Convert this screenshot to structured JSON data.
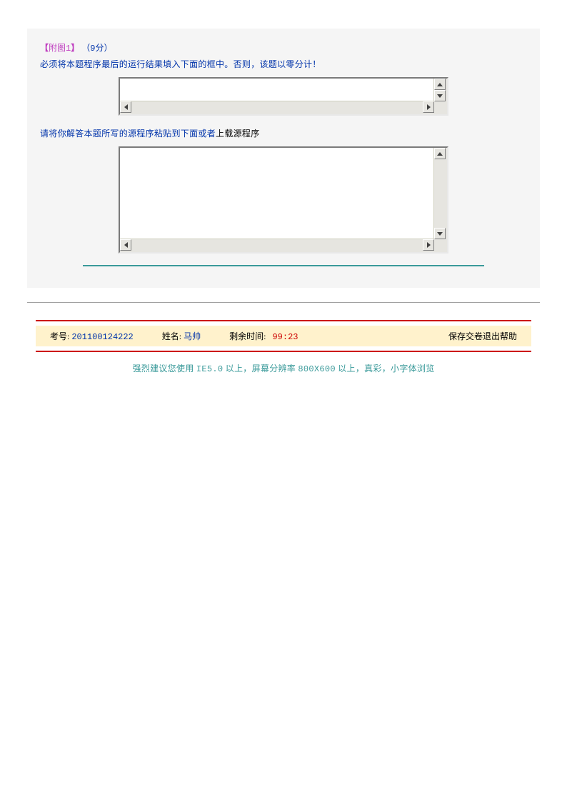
{
  "header": {
    "bracket_open": "【",
    "attach_label": "附图",
    "attach_num": "1",
    "bracket_close": "】",
    "points_open": "（",
    "points_num": "9",
    "points_unit": "分",
    "points_close": "）"
  },
  "instruction1": "必须将本题程序最后的运行结果填入下面的框中。否则，该题以零分计！",
  "instruction2_prefix": "请将你解答本题所写的源程序粘贴到下面或者",
  "instruction2_link": "上载源程序",
  "textarea1": {
    "value": ""
  },
  "textarea2": {
    "value": ""
  },
  "status": {
    "exam_label": "考号:",
    "exam_id": "201100124222",
    "name_label": "姓名:",
    "name_value": "马帅",
    "time_label": "剩余时间:",
    "time_value": "99:23",
    "links": {
      "save": "保存",
      "submit": "交卷",
      "exit": "退出",
      "help": "帮助"
    }
  },
  "recommend": {
    "prefix": "强烈建议您使用 ",
    "ie": "IE5.0",
    "mid1": " 以上，屏幕分辨率 ",
    "res": "800X600",
    "suffix": " 以上，真彩，小字体浏览"
  }
}
